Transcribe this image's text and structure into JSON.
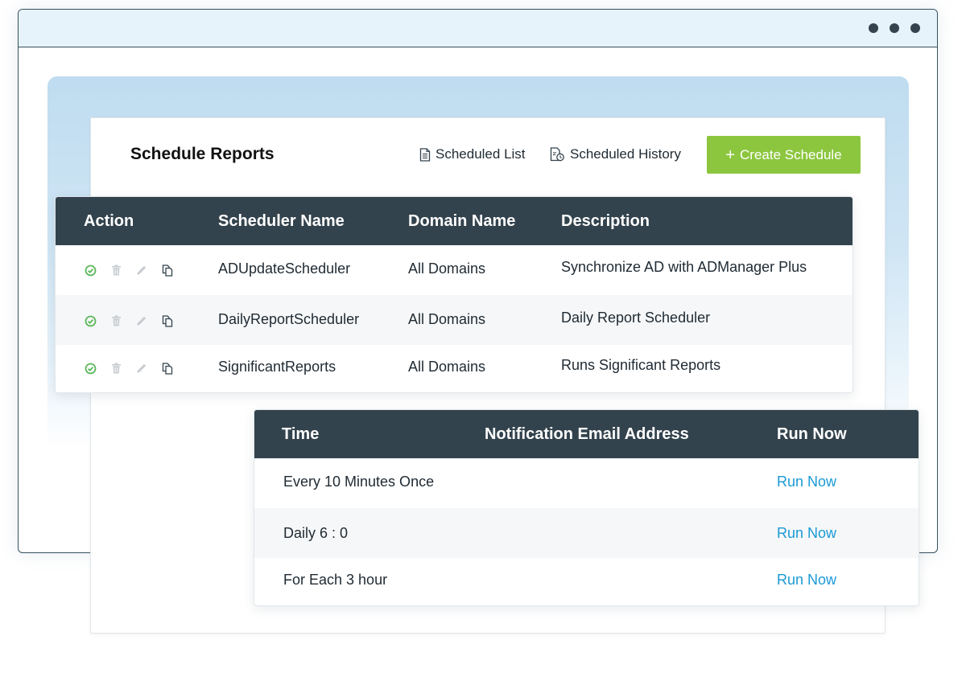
{
  "page": {
    "title": "Schedule Reports",
    "scheduled_list_label": "Scheduled List",
    "scheduled_history_label": "Scheduled History",
    "create_schedule_label": "Create Schedule",
    "create_plus": "+"
  },
  "colors": {
    "accent_green": "#8cc63f",
    "header_dark": "#33434d",
    "link_blue": "#1a9ad6",
    "backdrop_blue": "#bfdcf0"
  },
  "schedulers": {
    "headers": {
      "action": "Action",
      "scheduler_name": "Scheduler Name",
      "domain_name": "Domain Name",
      "description": "Description"
    },
    "action_icons": [
      "enable-check-icon",
      "trash-icon",
      "pencil-icon",
      "copy-icon"
    ],
    "rows": [
      {
        "name": "ADUpdateScheduler",
        "domain": "All Domains",
        "description": "Synchronize AD with ADManager Plus"
      },
      {
        "name": "DailyReportScheduler",
        "domain": "All Domains",
        "description": "Daily Report Scheduler"
      },
      {
        "name": "SignificantReports",
        "domain": "All Domains",
        "description": "Runs Significant Reports"
      }
    ]
  },
  "run_table": {
    "headers": {
      "time": "Time",
      "email": "Notification Email Address",
      "run_now": "Run Now"
    },
    "rows": [
      {
        "time": "Every 10 Minutes Once",
        "email": "",
        "run_now": "Run Now"
      },
      {
        "time": "Daily 6 : 0",
        "email": "",
        "run_now": "Run Now"
      },
      {
        "time": "For Each 3 hour",
        "email": "",
        "run_now": "Run Now"
      }
    ]
  }
}
